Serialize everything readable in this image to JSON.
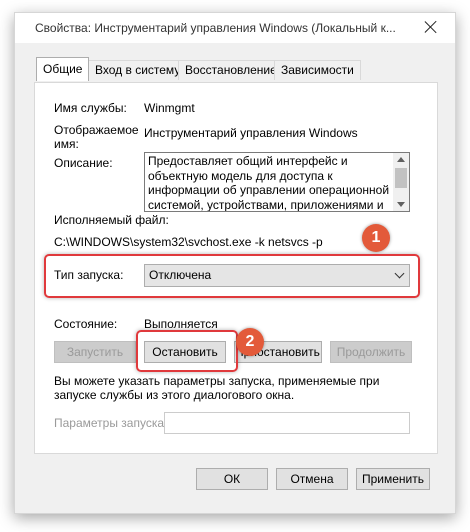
{
  "window": {
    "title": "Свойства: Инструментарий управления Windows (Локальный к..."
  },
  "tabs": [
    {
      "label": "Общие"
    },
    {
      "label": "Вход в систему"
    },
    {
      "label": "Восстановление"
    },
    {
      "label": "Зависимости"
    }
  ],
  "general": {
    "service_name_label": "Имя службы:",
    "service_name_value": "Winmgmt",
    "display_name_label": "Отображаемое имя:",
    "display_name_label_line1": "Отображаемое",
    "display_name_label_line2": "имя:",
    "display_name_value": "Инструментарий управления Windows",
    "description_label": "Описание:",
    "description_value": "Предоставляет общий интерфейс и объектную модель для доступа к информации об управлении операционной системой, устройствами, приложениями и службами.",
    "exe_label": "Исполняемый файл:",
    "exe_value": "C:\\WINDOWS\\system32\\svchost.exe -k netsvcs -p",
    "startup_type_label": "Тип запуска:",
    "startup_type_value": "Отключена",
    "status_label": "Состояние:",
    "status_value": "Выполняется",
    "buttons": {
      "start": "Запустить",
      "stop": "Остановить",
      "pause": "Приостановить",
      "resume": "Продолжить"
    },
    "hint_text": "Вы можете указать параметры запуска, применяемые при запуске службы из этого диалогового окна.",
    "start_params_label": "Параметры запуска:",
    "start_params_value": ""
  },
  "footer": {
    "ok": "ОК",
    "cancel": "Отмена",
    "apply": "Применить"
  },
  "annotations": {
    "badge1": "1",
    "badge2": "2",
    "color": "#e0393c"
  }
}
